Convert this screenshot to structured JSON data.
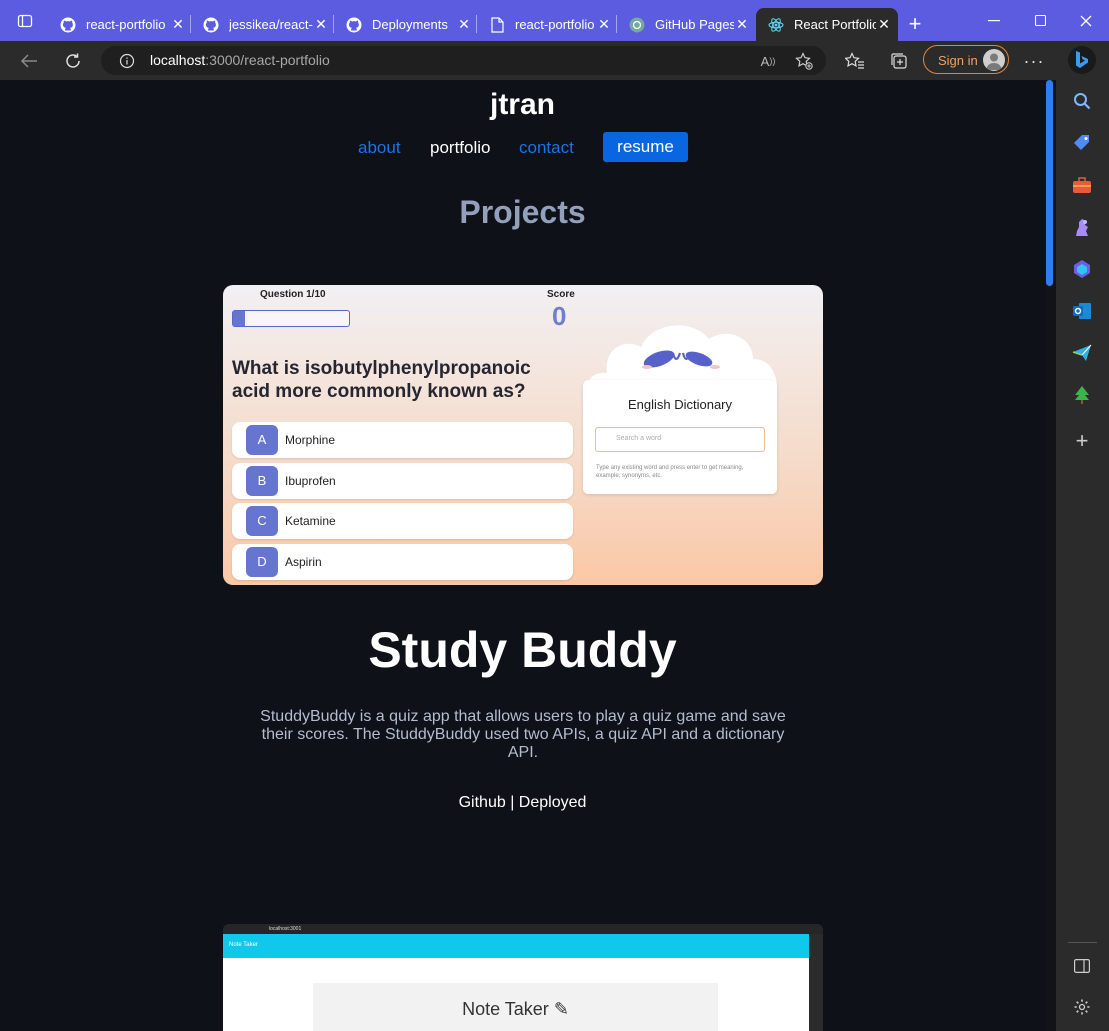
{
  "browser": {
    "tabs": [
      {
        "label": "react-portfolio",
        "icon": "github-icon",
        "active": false
      },
      {
        "label": "jessikea/react-",
        "icon": "github-icon",
        "active": false
      },
      {
        "label": "Deployments",
        "icon": "github-icon",
        "active": false
      },
      {
        "label": "react-portfolio",
        "icon": "file-icon",
        "active": false
      },
      {
        "label": "GitHub Pages",
        "icon": "chatgpt-icon",
        "active": false
      },
      {
        "label": "React Portfolio",
        "icon": "react-icon",
        "active": true
      }
    ],
    "address": {
      "host": "localhost",
      "path": ":3000/react-portfolio"
    },
    "sign_in_label": "Sign in",
    "accent": "#5b5ce0"
  },
  "site": {
    "brand": "jtran",
    "nav": {
      "about": "about",
      "portfolio": "portfolio",
      "contact": "contact",
      "resume": "resume"
    },
    "section_heading": "Projects",
    "project": {
      "title": "Study Buddy",
      "description": "StuddyBuddy is a quiz app that allows users to play a quiz game and save their scores. The StuddyBuddy used two APIs, a quiz API and a dictionary API.",
      "links": {
        "github": "Github",
        "separator": "|",
        "deployed": "Deployed"
      }
    },
    "screenshot_quiz": {
      "question_counter": "Question 1/10",
      "score_label": "Score",
      "score_value": "0",
      "progress": 0.1,
      "question": "What is isobutylphenylpropanoic acid more commonly known as?",
      "options": [
        {
          "letter": "A",
          "text": "Morphine"
        },
        {
          "letter": "B",
          "text": "Ibuprofen"
        },
        {
          "letter": "C",
          "text": "Ketamine"
        },
        {
          "letter": "D",
          "text": "Aspirin"
        }
      ],
      "dictionary": {
        "title": "English Dictionary",
        "placeholder": "Search a word",
        "help": "Type any existing word and press enter to get meaning, example, synonyms, etc."
      }
    },
    "screenshot_notes": {
      "url": "localhost:3001",
      "header": "Note Taker",
      "title": "Note Taker"
    }
  }
}
